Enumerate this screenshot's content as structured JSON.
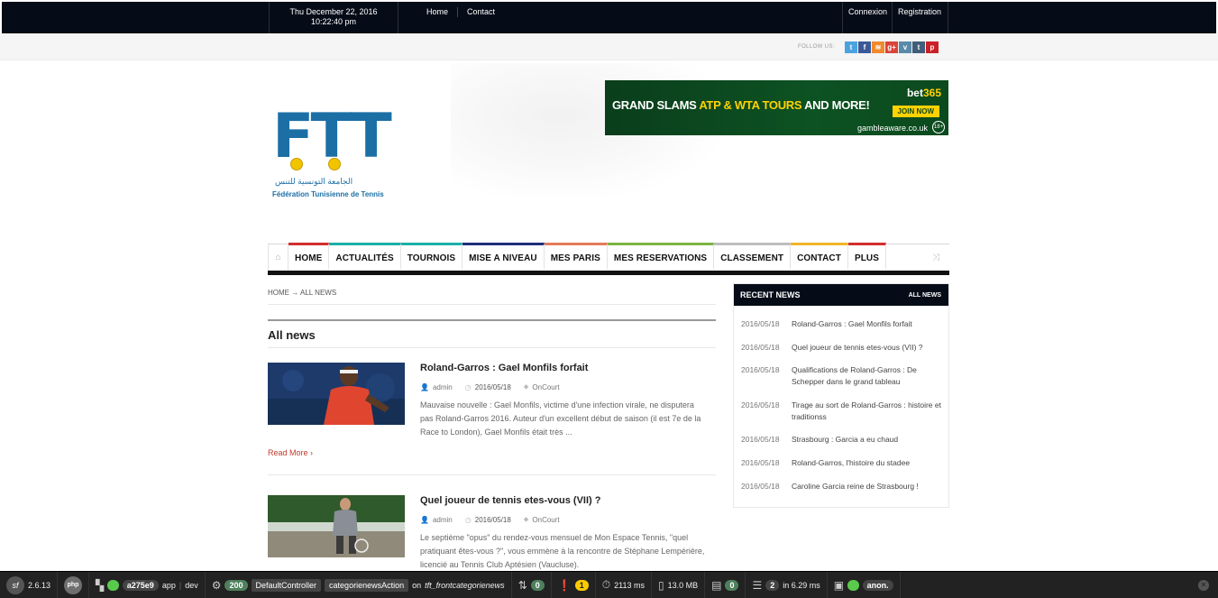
{
  "topbar": {
    "date": "Thu December 22, 2016",
    "time": "10:22:40 pm",
    "nav": [
      "Home",
      "Contact"
    ],
    "account": [
      "Connexion",
      "Registration"
    ]
  },
  "follow": {
    "label": "FOLLOW US:",
    "icons": [
      {
        "name": "twitter-icon",
        "glyph": "t",
        "color": "#4aa3df"
      },
      {
        "name": "facebook-icon",
        "glyph": "f",
        "color": "#3b5998"
      },
      {
        "name": "rss-icon",
        "glyph": "≋",
        "color": "#f1892d"
      },
      {
        "name": "google-plus-icon",
        "glyph": "g+",
        "color": "#d9453b"
      },
      {
        "name": "vimeo-icon",
        "glyph": "v",
        "color": "#5a8aa8"
      },
      {
        "name": "tumblr-icon",
        "glyph": "t",
        "color": "#3f5e7a"
      },
      {
        "name": "pinterest-icon",
        "glyph": "p",
        "color": "#cb2027"
      }
    ]
  },
  "logo": {
    "letters": "FTT",
    "arabic": "الجامعة التونسية للتنس",
    "federation": "Fédération Tunisienne de Tennis"
  },
  "banner": {
    "text_a": "GRAND SLAMS ",
    "text_b": "ATP & WTA TOURS",
    "text_c": " AND MORE!",
    "brand_a": "bet",
    "brand_b": "365",
    "join": "JOIN NOW",
    "gamble": "gambleaware.co.uk",
    "age": "18+"
  },
  "nav": {
    "items": [
      {
        "label": "HOME",
        "color": "#d32f2f"
      },
      {
        "label": "ACTUALITÉS",
        "color": "#1bb0a8"
      },
      {
        "label": "TOURNOIS",
        "color": "#1bb0a8"
      },
      {
        "label": "MISE A NIVEAU",
        "color": "#1f2f7a"
      },
      {
        "label": "MES PARIS",
        "color": "#e57b5a"
      },
      {
        "label": "MES RESERVATIONS",
        "color": "#7cb342"
      },
      {
        "label": "CLASSEMENT",
        "color": "#bdbdbd"
      },
      {
        "label": "CONTACT",
        "color": "#f0b429"
      },
      {
        "label": "PLUS",
        "color": "#d32f2f"
      }
    ]
  },
  "breadcrumb": {
    "home": "HOME",
    "sep": "→",
    "current": "ALL NEWS"
  },
  "section": {
    "title": "All news"
  },
  "articles": [
    {
      "title": "Roland-Garros : Gael Monfils forfait",
      "author": "admin",
      "date": "2016/05/18",
      "category": "OnCourt",
      "excerpt": "Mauvaise nouvelle : Gael Monfils, victime d'une infection virale, ne disputera pas Roland-Garros 2016. Auteur d'un excellent début de saison (il est 7e de la Race to London), Gael Monfils était très ...",
      "readmore": "Read More"
    },
    {
      "title": "Quel joueur de tennis etes-vous (VII) ?",
      "author": "admin",
      "date": "2016/05/18",
      "category": "OnCourt",
      "excerpt": "Le septième \"opus\" du rendez-vous mensuel de Mon Espace Tennis, \"quel pratiquant êtes-vous ?\", vous emmène à la rencontre de Stéphane Lempérière, licencié au Tennis Club Aptésien (Vaucluse)."
    }
  ],
  "recent": {
    "title": "RECENT NEWS",
    "all": "ALL NEWS",
    "items": [
      {
        "date": "2016/05/18",
        "title": "Roland-Garros : Gael Monfils forfait"
      },
      {
        "date": "2016/05/18",
        "title": "Quel joueur de tennis etes-vous (VII) ?"
      },
      {
        "date": "2016/05/18",
        "title": "Qualifications de Roland-Garros : De Schepper dans le grand tableau"
      },
      {
        "date": "2016/05/18",
        "title": "Tirage au sort de Roland-Garros : histoire et traditionss"
      },
      {
        "date": "2016/05/18",
        "title": "Strasbourg : Garcia a eu chaud"
      },
      {
        "date": "2016/05/18",
        "title": "Roland-Garros, l'histoire du stadee"
      },
      {
        "date": "2016/05/18",
        "title": "Caroline Garcia reine de Strasbourg !"
      }
    ]
  },
  "debug": {
    "version": "2.6.13",
    "token": "a275e9",
    "app": "app",
    "env": "dev",
    "status": "200",
    "controller": "DefaultController",
    "action": "categorienewsAction",
    "route_prefix": "on",
    "route": "tft_frontcategorienews",
    "ajax": "0",
    "errors": "1",
    "time": "2113 ms",
    "memory": "13.0 MB",
    "forms": "0",
    "queries": "2",
    "query_time": "in 6.29 ms",
    "user": "anon."
  }
}
